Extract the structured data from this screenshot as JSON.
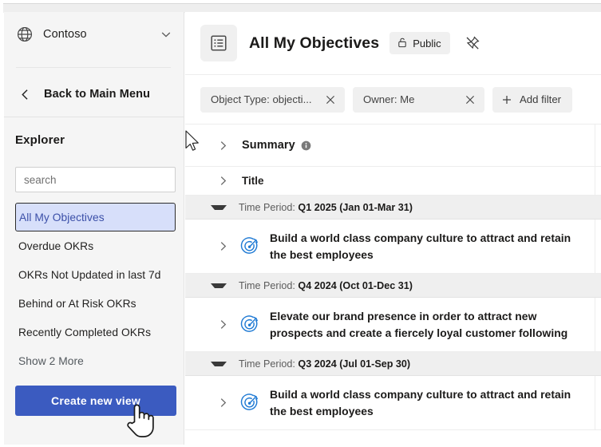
{
  "sidebar": {
    "org": {
      "name": "Contoso",
      "globe_icon": "globe-icon",
      "chevron_icon": "chevron-down-icon"
    },
    "back": {
      "label": "Back to Main Menu",
      "icon": "chevron-left-icon"
    },
    "explorer_title": "Explorer",
    "search": {
      "placeholder": "search",
      "value": ""
    },
    "views": [
      {
        "label": "All My Objectives",
        "selected": true
      },
      {
        "label": "Overdue OKRs",
        "selected": false
      },
      {
        "label": "OKRs Not Updated in last 7d",
        "selected": false
      },
      {
        "label": "Behind or At Risk OKRs",
        "selected": false
      },
      {
        "label": "Recently Completed OKRs",
        "selected": false
      },
      {
        "label": "Show 2 More",
        "selected": false,
        "muted": true
      }
    ],
    "create_button": "Create new view"
  },
  "header": {
    "view_icon": "list-view-icon",
    "title": "All My Objectives",
    "visibility_badge": {
      "label": "Public",
      "icon": "unlock-icon"
    },
    "unpin_icon": "unpin-icon"
  },
  "filters": {
    "chips": [
      {
        "label": "Object Type: objecti...",
        "close_icon": "close-icon"
      },
      {
        "label": "Owner: Me",
        "close_icon": "close-icon"
      }
    ],
    "add_filter": {
      "label": "Add filter",
      "icon": "plus-icon"
    }
  },
  "table": {
    "summary_row": {
      "label": "Summary",
      "chevron_icon": "chevron-right-icon",
      "info_icon": "info-icon"
    },
    "title_row": {
      "label": "Title",
      "chevron_icon": "chevron-right-icon"
    },
    "groups": [
      {
        "prefix": "Time Period: ",
        "value": "Q1 2025 (Jan 01-Mar 31)",
        "collapse_icon": "triangle-down-icon",
        "items": [
          {
            "text": "Build a world class company culture to attract and retain the best employees",
            "icon": "objective-target-icon",
            "chevron_icon": "chevron-right-icon"
          }
        ]
      },
      {
        "prefix": "Time Period: ",
        "value": "Q4 2024 (Oct 01-Dec 31)",
        "collapse_icon": "triangle-down-icon",
        "items": [
          {
            "text": "Elevate our brand presence in order to attract new prospects and create a fiercely loyal customer following",
            "icon": "objective-target-icon",
            "chevron_icon": "chevron-right-icon"
          }
        ]
      },
      {
        "prefix": "Time Period: ",
        "value": "Q3 2024 (Jul 01-Sep 30)",
        "collapse_icon": "triangle-down-icon",
        "items": [
          {
            "text": "Build a world class company culture to attract and retain the best employees",
            "icon": "objective-target-icon",
            "chevron_icon": "chevron-right-icon"
          }
        ]
      }
    ]
  },
  "colors": {
    "accent": "#3b5bc0",
    "selected_item_bg": "#d7dffa",
    "selected_item_text": "#3b4fa8",
    "objective_icon": "#1f7ad4",
    "group_row_bg": "#efefef",
    "sidebar_bg": "#f5f5f5"
  },
  "cursors": [
    {
      "type": "arrow-cursor"
    },
    {
      "type": "hand-pointer-cursor"
    }
  ]
}
